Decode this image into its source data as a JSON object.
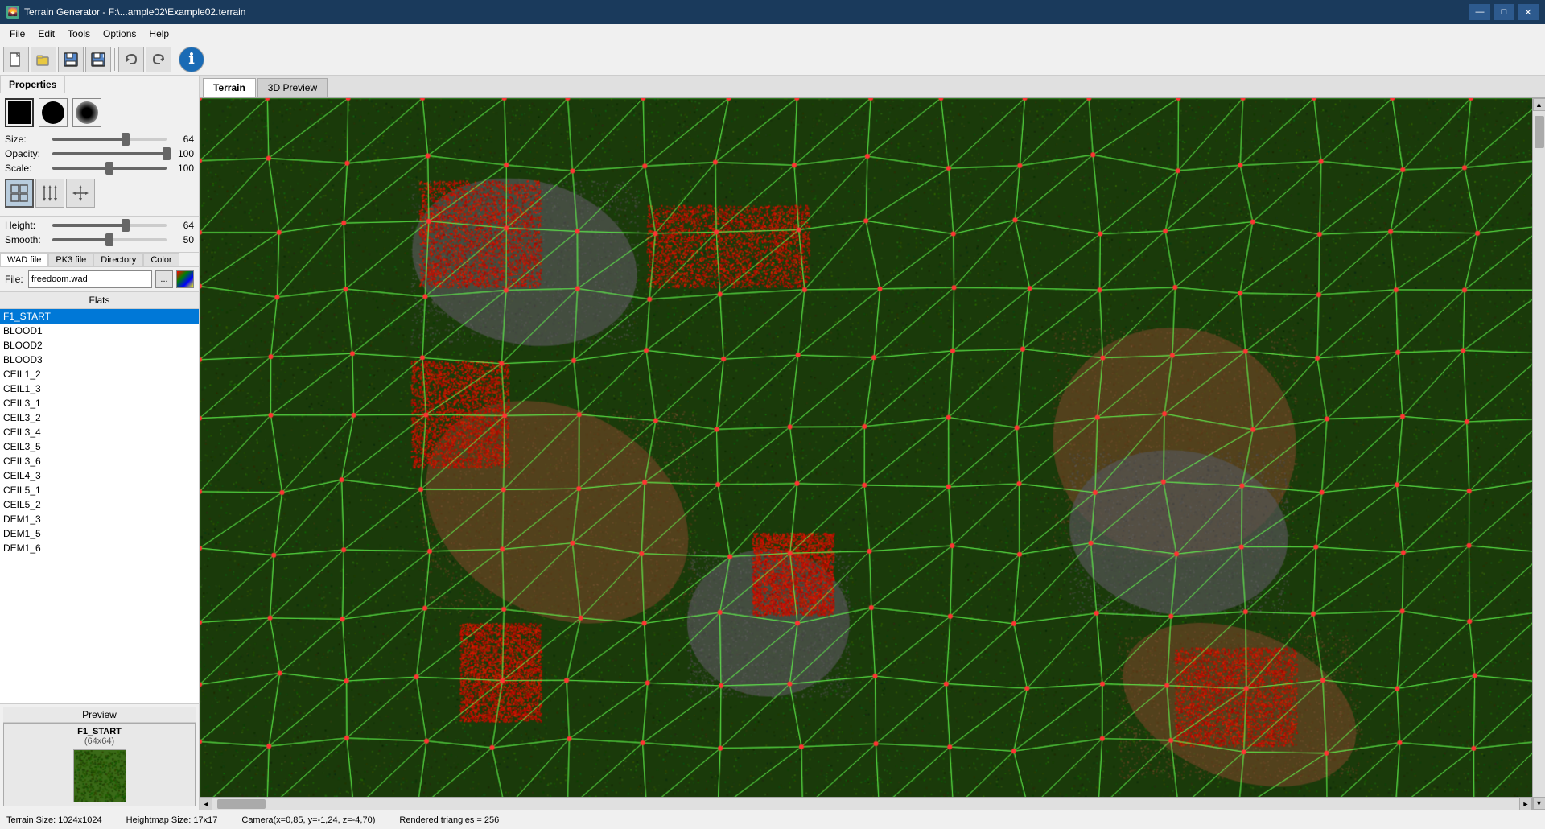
{
  "titlebar": {
    "icon": "🌄",
    "title": "Terrain Generator - F:\\...ample02\\Example02.terrain",
    "minimize": "—",
    "maximize": "□",
    "close": "✕"
  },
  "menubar": {
    "items": [
      "File",
      "Edit",
      "Tools",
      "Options",
      "Help"
    ]
  },
  "toolbar": {
    "buttons": [
      {
        "name": "new",
        "icon": "📄"
      },
      {
        "name": "open",
        "icon": "📂"
      },
      {
        "name": "save",
        "icon": "💾"
      },
      {
        "name": "save-as",
        "icon": "🖫"
      },
      {
        "name": "undo",
        "icon": "↩"
      },
      {
        "name": "redo",
        "icon": "↪"
      },
      {
        "name": "info",
        "icon": "ℹ"
      }
    ]
  },
  "properties": {
    "tab_label": "Properties",
    "brush": {
      "shapes": [
        "square",
        "circle",
        "soft"
      ],
      "size_label": "Size:",
      "size_value": "64",
      "size_pct": 64,
      "opacity_label": "Opacity:",
      "opacity_value": "100",
      "opacity_pct": 100,
      "scale_label": "Scale:",
      "scale_value": "100",
      "scale_pct": 100
    },
    "modes": [
      "grid",
      "arrows-ud",
      "arrows-spread"
    ],
    "height_label": "Height:",
    "height_value": "64",
    "height_pct": 64,
    "smooth_label": "Smooth:",
    "smooth_value": "50",
    "smooth_pct": 50
  },
  "texture": {
    "tabs": [
      "WAD file",
      "PK3 file",
      "Directory",
      "Color"
    ],
    "active_tab": "WAD file",
    "file_label": "File:",
    "file_value": "freedoom.wad",
    "dots_label": "...",
    "flats_label": "Flats",
    "items": [
      "F1_START",
      "BLOOD1",
      "BLOOD2",
      "BLOOD3",
      "CEIL1_2",
      "CEIL1_3",
      "CEIL3_1",
      "CEIL3_2",
      "CEIL3_4",
      "CEIL3_5",
      "CEIL3_6",
      "CEIL4_3",
      "CEIL5_1",
      "CEIL5_2",
      "DEM1_3",
      "DEM1_5",
      "DEM1_6"
    ],
    "selected": "F1_START"
  },
  "preview": {
    "label": "Preview",
    "name": "F1_START",
    "size": "(64x64)"
  },
  "tabs": {
    "terrain_label": "Terrain",
    "preview_3d_label": "3D Preview",
    "active": "Terrain"
  },
  "statusbar": {
    "terrain_size": "Terrain Size: 1024x1024",
    "heightmap_size": "Heightmap Size: 17x17",
    "camera": "Camera(x=0,85, y=-1,24, z=-4,70)",
    "triangles": "Rendered triangles = 256"
  }
}
